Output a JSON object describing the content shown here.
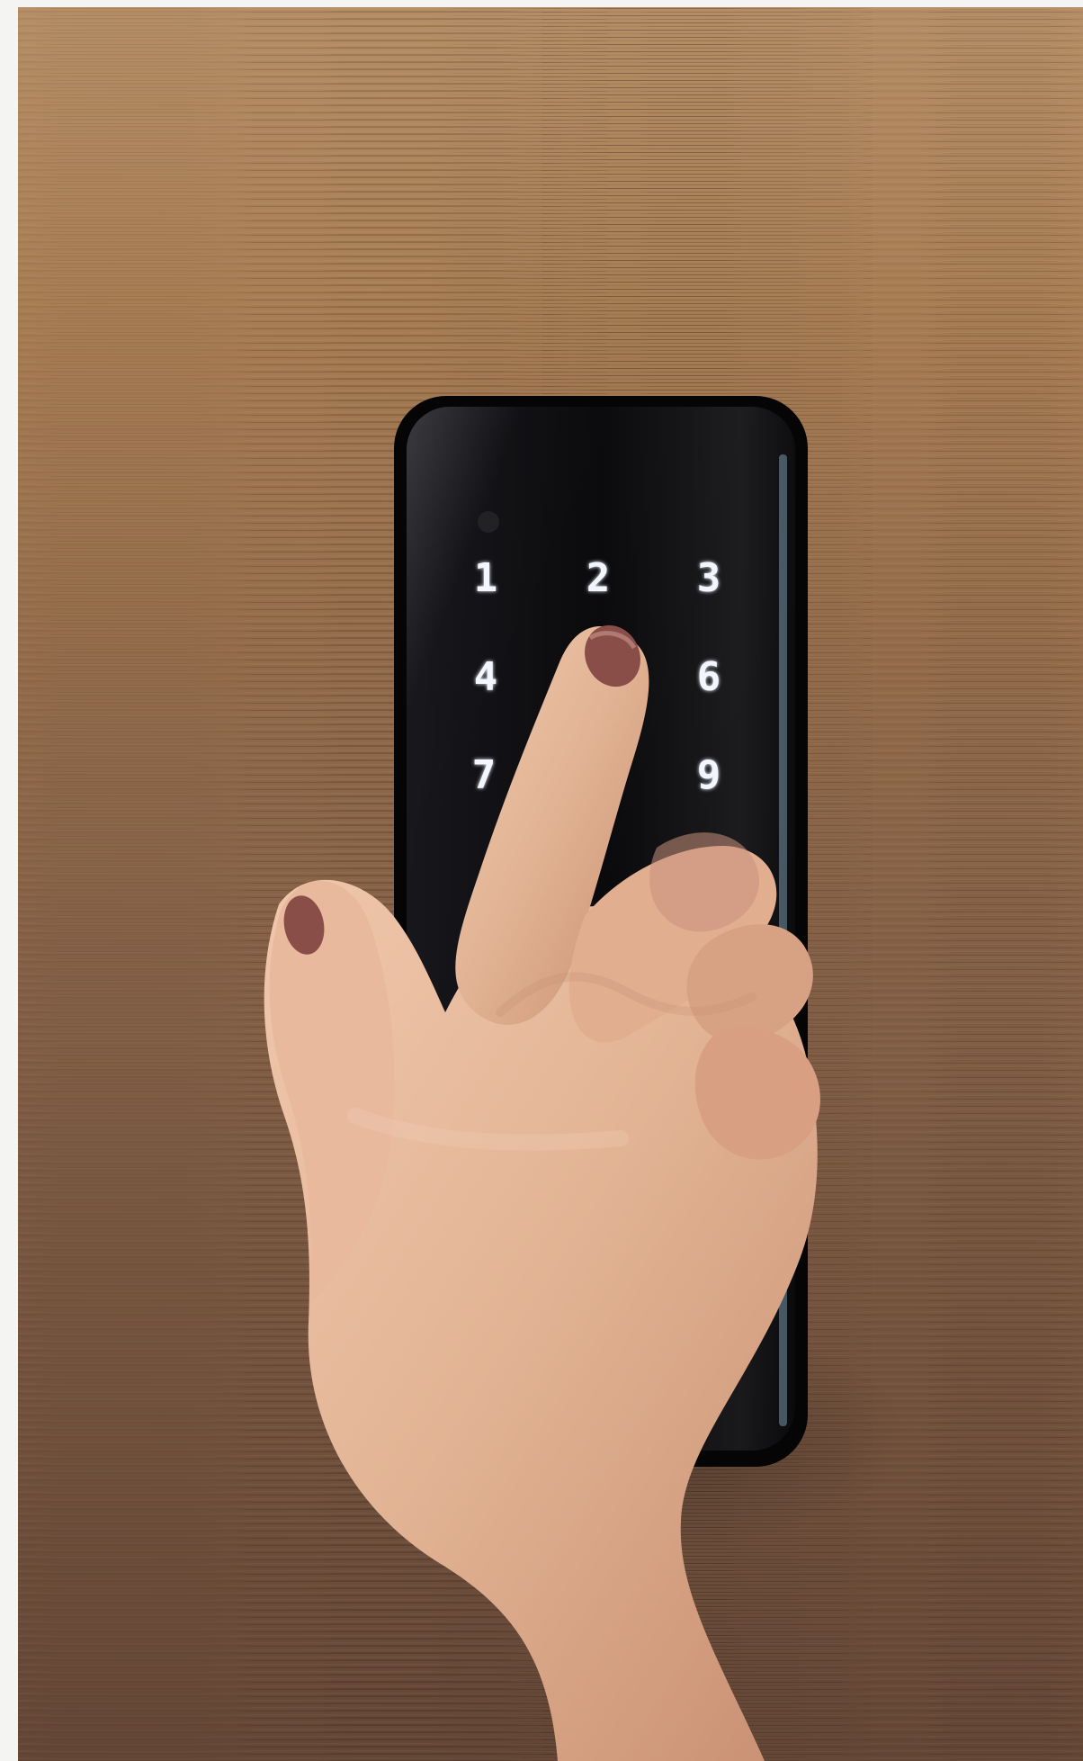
{
  "scene": {
    "colors": {
      "wood_light": "#b98a5e",
      "wood_mid": "#8d6547",
      "wood_dark": "#6e4f3a",
      "panel": "#0d0d10",
      "skin": "#e3b596",
      "skin_shadow": "#c78f72",
      "nail": "#8a4e48",
      "key_glow": "#f3f6ff"
    }
  },
  "keypad": {
    "keys": [
      {
        "label": "1",
        "state": "visible"
      },
      {
        "label": "2",
        "state": "visible"
      },
      {
        "label": "3",
        "state": "visible"
      },
      {
        "label": "4",
        "state": "visible"
      },
      {
        "label": "6",
        "state": "visible"
      },
      {
        "label": "7",
        "state": "partially-hidden"
      },
      {
        "label": "9",
        "state": "visible"
      }
    ]
  }
}
